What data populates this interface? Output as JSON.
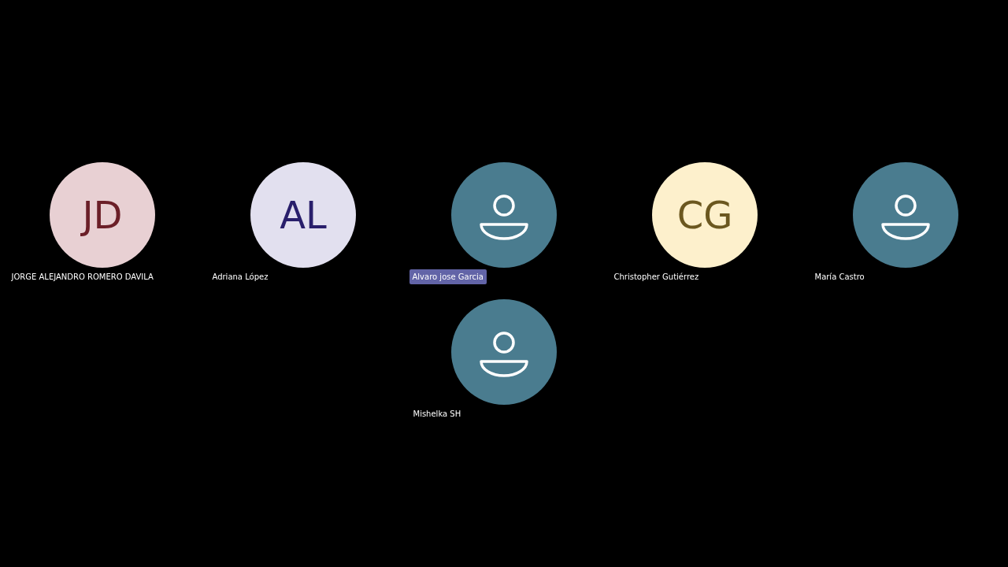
{
  "participants": [
    {
      "name": "JORGE ALEJANDRO ROMERO DAVILA",
      "kind": "initials",
      "initials": "JD",
      "color": "#e8d0d3",
      "speaking": false
    },
    {
      "name": "Adriana López",
      "kind": "initials",
      "initials": "AL",
      "color": "#e2e0ef",
      "speaking": false
    },
    {
      "name": "Alvaro jose Garcia",
      "kind": "placeholder",
      "color": "#4a7c8f",
      "speaking": true
    },
    {
      "name": "Christopher Gutiérrez",
      "kind": "initials",
      "initials": "CG",
      "color": "#fdf0cc",
      "speaking": false
    },
    {
      "name": "María Castro",
      "kind": "placeholder",
      "color": "#4a7c8f",
      "speaking": false
    },
    {
      "name": "Mishelka SH",
      "kind": "placeholder",
      "color": "#4a7c8f",
      "speaking": false
    }
  ]
}
